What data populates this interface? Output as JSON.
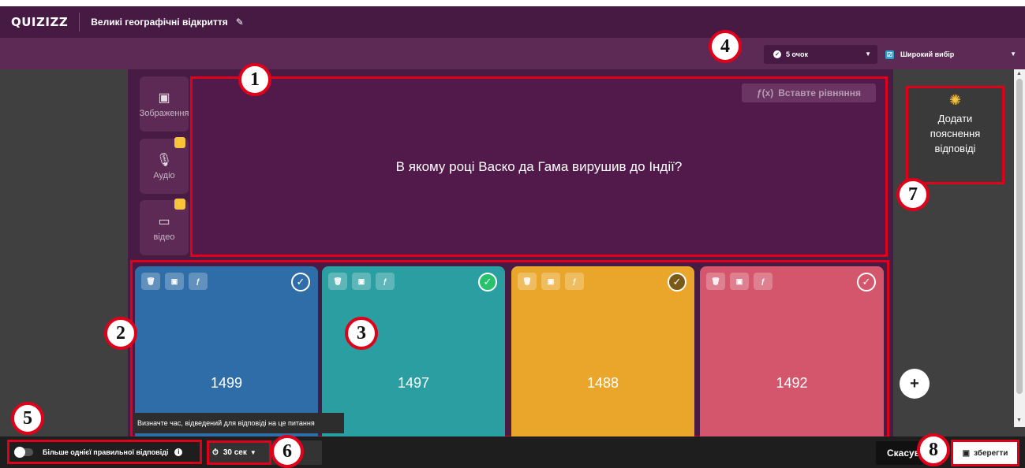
{
  "header": {
    "logo": "QUIZIZZ",
    "quiz_title": "Великі географічні відкриття",
    "edit_icon": "pencil-icon"
  },
  "toolbar": {
    "points_label": "5 очок",
    "question_type_label": "Широкий вибір"
  },
  "media": {
    "image_label": "Зображення",
    "audio_label": "Аудіо",
    "video_label": "відео"
  },
  "question": {
    "text": "В якому році Васко да Гама вирушив до Індії?",
    "equation_label": "Вставте рівняння"
  },
  "answers": [
    {
      "value": "1499",
      "color": "#2f6da9",
      "correct": false
    },
    {
      "value": "1497",
      "color": "#2a9ea0",
      "correct": true
    },
    {
      "value": "1488",
      "color": "#eaa62b",
      "correct": false
    },
    {
      "value": "1492",
      "color": "#d4566c",
      "correct": false
    }
  ],
  "explanation": {
    "line1": "Додати",
    "line2": "пояснення",
    "line3": "відповіді"
  },
  "tooltip": "Визначте час, відведений для відповіді на це питання",
  "footer": {
    "multi_correct_label": "Більше однієї правильної відповіді",
    "time_label": "30 сек",
    "cancel_label": "Скасувати",
    "save_label": "зберегти"
  },
  "callouts": [
    "1",
    "2",
    "3",
    "4",
    "5",
    "6",
    "7",
    "8"
  ],
  "colors": {
    "header": "#461a42",
    "subbar": "#5c2a55",
    "highlight": "#e0001a"
  }
}
